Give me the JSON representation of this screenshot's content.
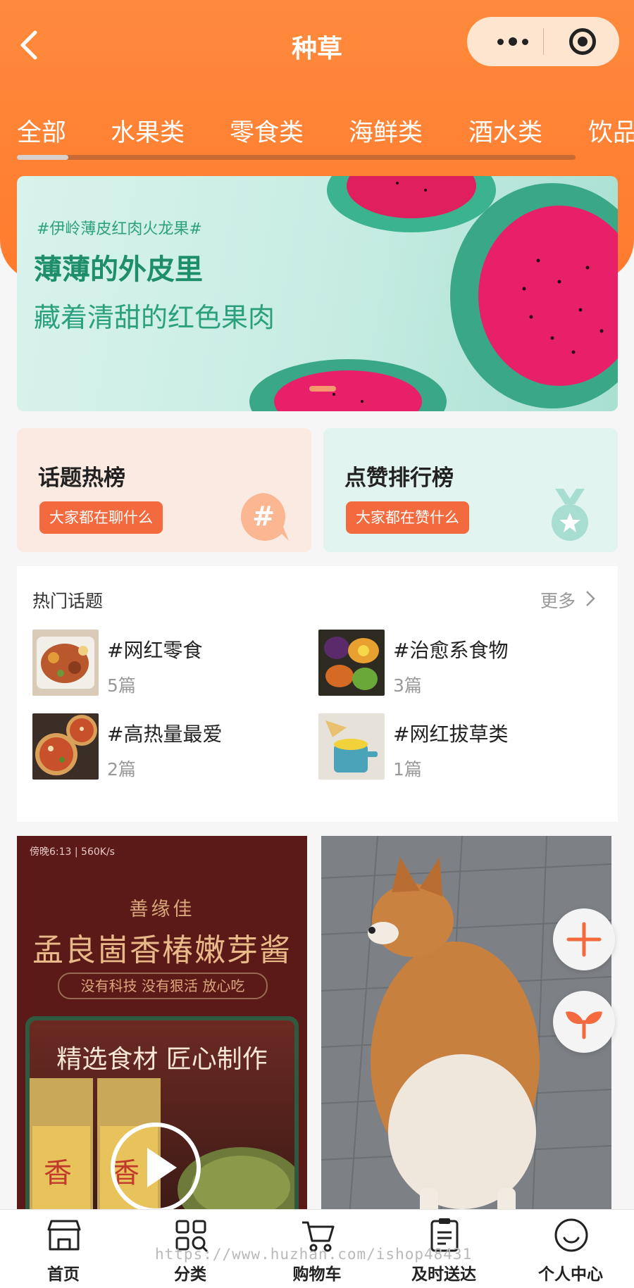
{
  "header": {
    "title": "种草",
    "back_icon": "chevron-left-icon",
    "menu_icon": "more-dots-icon",
    "close_icon": "target-icon"
  },
  "tabs": [
    "全部",
    "水果类",
    "零食类",
    "海鲜类",
    "酒水类",
    "饮品"
  ],
  "banner": {
    "hashtag": "#伊岭薄皮红肉火龙果#",
    "line1": "薄薄的外皮里",
    "line2": "藏着清甜的红色果肉"
  },
  "rank_cards": [
    {
      "title": "话题热榜",
      "button": "大家都在聊什么",
      "icon": "hashtag-bubble-icon"
    },
    {
      "title": "点赞排行榜",
      "button": "大家都在赞什么",
      "icon": "medal-icon"
    }
  ],
  "hot_topics": {
    "title": "热门话题",
    "more": "更多",
    "items": [
      {
        "name": "#网红零食",
        "count": "5篇"
      },
      {
        "name": "#治愈系食物",
        "count": "3篇"
      },
      {
        "name": "#高热量最爱",
        "count": "2篇"
      },
      {
        "name": "#网红拔草类",
        "count": "1篇"
      }
    ]
  },
  "feed": {
    "left": {
      "status": "傍晚6:13 | 560K/s",
      "brand": "善缘佳",
      "product": "孟良崮香椿嫩芽酱",
      "slogan": "没有科技 没有狠活 放心吃",
      "inner_title": "精选食材 匠心制作"
    }
  },
  "tabbar": [
    {
      "label": "首页",
      "icon": "store-icon"
    },
    {
      "label": "分类",
      "icon": "category-grid-icon"
    },
    {
      "label": "购物车",
      "icon": "cart-icon"
    },
    {
      "label": "及时送达",
      "icon": "clipboard-icon"
    },
    {
      "label": "个人中心",
      "icon": "smile-icon"
    }
  ],
  "watermark": "https://www.huzhan.com/ishop48431",
  "colors": {
    "accent": "#ff7b2e",
    "button": "#f26a3d",
    "banner_text": "#1e8e6a"
  }
}
